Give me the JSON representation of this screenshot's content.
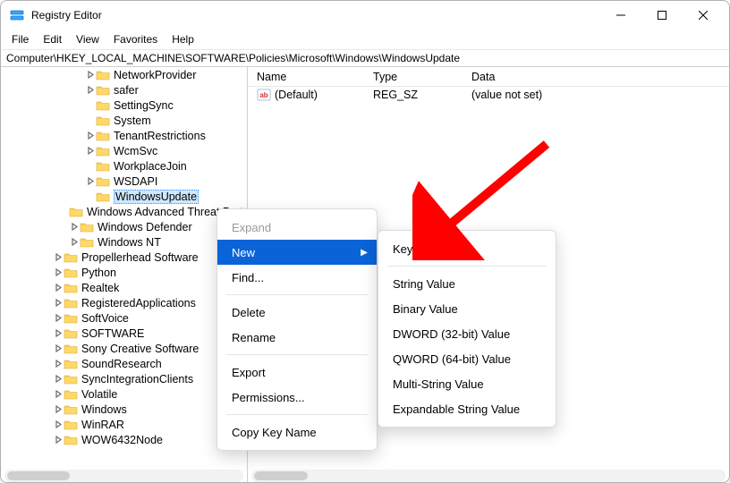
{
  "window": {
    "title": "Registry Editor"
  },
  "menubar": {
    "file": "File",
    "edit": "Edit",
    "view": "View",
    "favorites": "Favorites",
    "help": "Help"
  },
  "address": "Computer\\HKEY_LOCAL_MACHINE\\SOFTWARE\\Policies\\Microsoft\\Windows\\WindowsUpdate",
  "tree": {
    "items": [
      {
        "indent": 4,
        "expander": ">",
        "label": "NetworkProvider"
      },
      {
        "indent": 4,
        "expander": ">",
        "label": "safer"
      },
      {
        "indent": 4,
        "expander": "",
        "label": "SettingSync"
      },
      {
        "indent": 4,
        "expander": "",
        "label": "System"
      },
      {
        "indent": 4,
        "expander": ">",
        "label": "TenantRestrictions"
      },
      {
        "indent": 4,
        "expander": ">",
        "label": "WcmSvc"
      },
      {
        "indent": 4,
        "expander": "",
        "label": "WorkplaceJoin"
      },
      {
        "indent": 4,
        "expander": ">",
        "label": "WSDAPI"
      },
      {
        "indent": 4,
        "expander": "",
        "label": "WindowsUpdate",
        "selected": true
      },
      {
        "indent": 3,
        "expander": "",
        "label": "Windows Advanced Threat Protection",
        "trunc": "Windows Advanced"
      },
      {
        "indent": 3,
        "expander": ">",
        "label": "Windows Defender"
      },
      {
        "indent": 3,
        "expander": ">",
        "label": "Windows NT"
      },
      {
        "indent": 2,
        "expander": ">",
        "label": "Propellerhead Software"
      },
      {
        "indent": 2,
        "expander": ">",
        "label": "Python"
      },
      {
        "indent": 2,
        "expander": ">",
        "label": "Realtek"
      },
      {
        "indent": 2,
        "expander": ">",
        "label": "RegisteredApplications"
      },
      {
        "indent": 2,
        "expander": ">",
        "label": "SoftVoice"
      },
      {
        "indent": 2,
        "expander": ">",
        "label": "SOFTWARE"
      },
      {
        "indent": 2,
        "expander": ">",
        "label": "Sony Creative Software"
      },
      {
        "indent": 2,
        "expander": ">",
        "label": "SoundResearch"
      },
      {
        "indent": 2,
        "expander": ">",
        "label": "SyncIntegrationClients"
      },
      {
        "indent": 2,
        "expander": ">",
        "label": "Volatile"
      },
      {
        "indent": 2,
        "expander": ">",
        "label": "Windows"
      },
      {
        "indent": 2,
        "expander": ">",
        "label": "WinRAR"
      },
      {
        "indent": 2,
        "expander": ">",
        "label": "WOW6432Node"
      }
    ]
  },
  "list": {
    "columns": {
      "name": "Name",
      "type": "Type",
      "data": "Data"
    },
    "rows": [
      {
        "name": "(Default)",
        "type": "REG_SZ",
        "data": "(value not set)"
      }
    ]
  },
  "context_menu": {
    "expand": "Expand",
    "new": "New",
    "find": "Find...",
    "delete": "Delete",
    "rename": "Rename",
    "export": "Export",
    "permissions": "Permissions...",
    "copy_key_name": "Copy Key Name"
  },
  "submenu": {
    "key": "Key",
    "string": "String Value",
    "binary": "Binary Value",
    "dword": "DWORD (32-bit) Value",
    "qword": "QWORD (64-bit) Value",
    "multi": "Multi-String Value",
    "expand": "Expandable String Value"
  }
}
